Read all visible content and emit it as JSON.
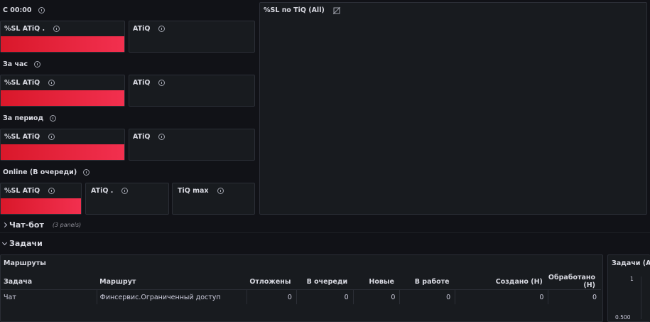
{
  "colors": {
    "background": "#111217",
    "panel": "#181b1f",
    "accent_red": "#e8243f"
  },
  "icons": {
    "info": "info-icon",
    "no_data": "no-data-icon",
    "chevron": "chevron-icon"
  },
  "sections": {
    "since": "С 00:00",
    "hour": "За час",
    "period": "За период",
    "online": "Online (В очереди)"
  },
  "stats": {
    "since": {
      "sl": "%SL ATiQ .",
      "atiq": "ATiQ"
    },
    "hour": {
      "sl": "%SL ATiQ",
      "atiq": "ATiQ"
    },
    "period": {
      "sl": "%SL ATiQ",
      "atiq": "ATiQ"
    },
    "online": {
      "sl": "%SL ATiQ",
      "atiq": "ATiQ .",
      "tiq": "TiQ max"
    }
  },
  "chart_panel": {
    "title": "%SL по TiQ (All)"
  },
  "rows": {
    "chatbot": {
      "title": "Чат-бот",
      "meta": "(3 panels)"
    },
    "tasks": {
      "title": "Задачи"
    }
  },
  "routes_panel": {
    "title": "Маршруты",
    "columns": [
      "Задача",
      "Маршрут",
      "Отложены",
      "В очереди",
      "Новые",
      "В работе",
      "Создано (Н)",
      "Обработано (Н)"
    ],
    "rows": [
      [
        "Чат",
        "Финсервис.Ограниченный доступ",
        "0",
        "0",
        "0",
        "0",
        "0",
        "0"
      ]
    ]
  },
  "tasks_panel": {
    "title": "Задачи (All)",
    "y_ticks": [
      "1",
      "0.500"
    ]
  }
}
